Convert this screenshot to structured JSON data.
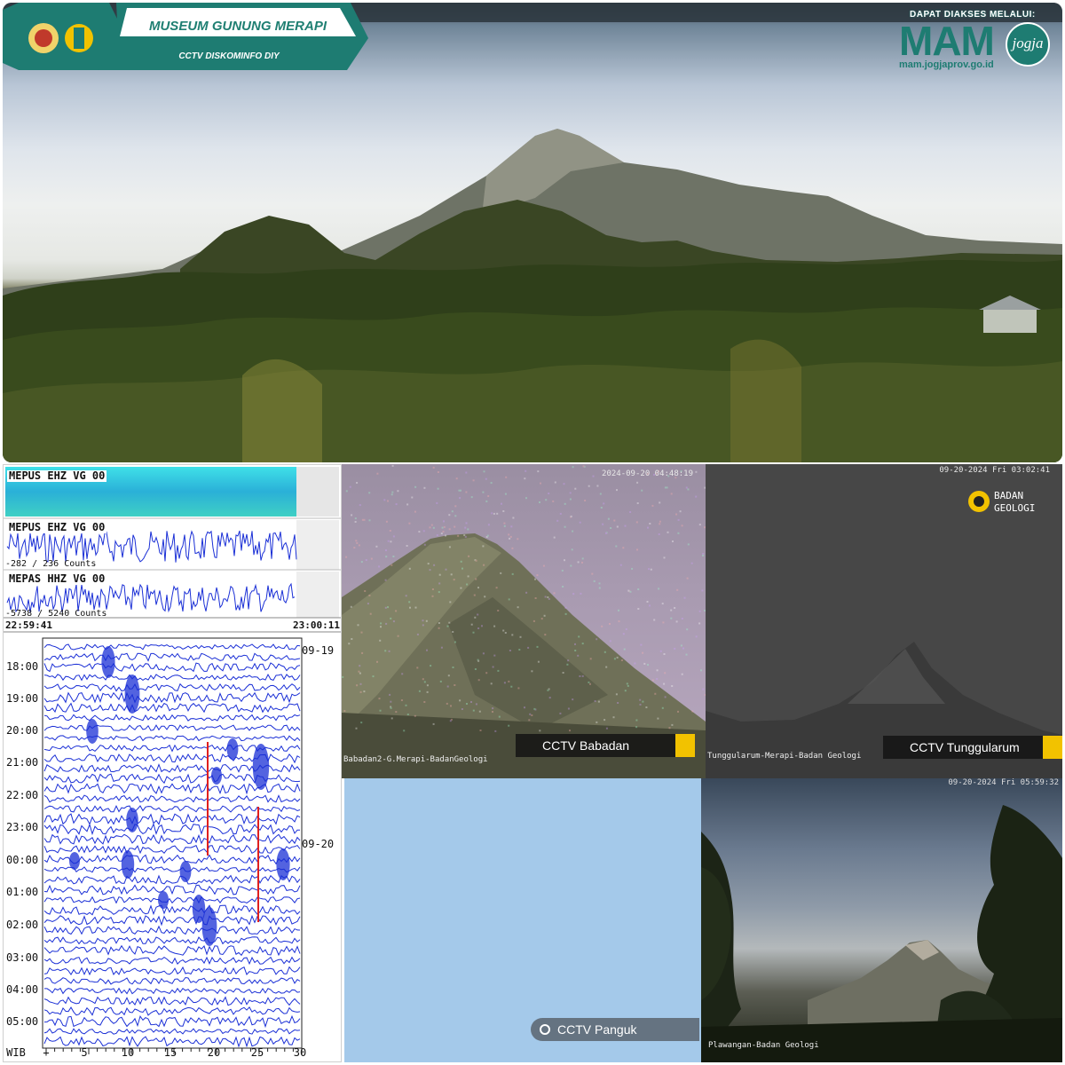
{
  "banner": {
    "title": "MUSEUM GUNUNG MERAPI",
    "subtitle": "CCTV DISKOMINFO DIY"
  },
  "mam": {
    "accessed_via": "DAPAT DIAKSES MELALUI:",
    "logo": "MAM",
    "url": "mam.jogjaprov.go.id",
    "jogja": "jogja"
  },
  "seismograph": {
    "traces": [
      {
        "label": "MEPUS EHZ VG 00"
      },
      {
        "label": "MEPUS EHZ VG 00",
        "counts": "-282 / 236 Counts"
      },
      {
        "label": "MEPAS HHZ VG 00",
        "counts": "-5738 / 5240 Counts"
      }
    ],
    "time_start": "22:59:41",
    "time_end": "23:00:11",
    "hours": [
      "18:00",
      "19:00",
      "20:00",
      "21:00",
      "22:00",
      "23:00",
      "00:00",
      "01:00",
      "02:00",
      "03:00",
      "04:00",
      "05:00"
    ],
    "dates": [
      "09-19",
      "09-20"
    ],
    "x_axis_unit": "WIB",
    "x_ticks": [
      "+",
      "5",
      "10",
      "15",
      "20",
      "25",
      "30"
    ],
    "colors": {
      "trace": "#1a2fd6",
      "marker": "#e0201e"
    }
  },
  "cctv": {
    "babadan": {
      "timestamp": "2024-09-20 04:48:19",
      "caption": "Babadan2-G.Merapi-BadanGeologi",
      "tag": "CCTV Babadan"
    },
    "tunggularum": {
      "timestamp": "09-20-2024 Fri 03:02:41",
      "caption": "Tunggularum-Merapi-Badan Geologi",
      "tag": "CCTV Tunggularum",
      "logo_line1": "BADAN",
      "logo_line2": "GEOLOGI"
    },
    "panguk": {
      "tag": "CCTV Panguk"
    },
    "plawangan": {
      "timestamp": "09-20-2024 Fri 05:59:32",
      "caption": "Plawangan-Badan Geologi"
    }
  },
  "colors": {
    "brand_teal": "#1e7c72",
    "tag_accent": "#f2c200"
  }
}
